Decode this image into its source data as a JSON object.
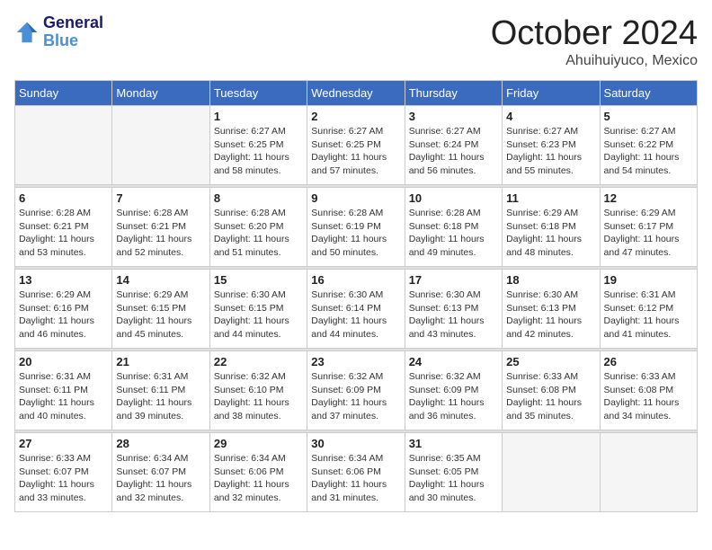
{
  "header": {
    "logo_line1": "General",
    "logo_line2": "Blue",
    "month": "October 2024",
    "location": "Ahuihuiyuco, Mexico"
  },
  "days_of_week": [
    "Sunday",
    "Monday",
    "Tuesday",
    "Wednesday",
    "Thursday",
    "Friday",
    "Saturday"
  ],
  "weeks": [
    [
      {
        "day": "",
        "sunrise": "",
        "sunset": "",
        "daylight": ""
      },
      {
        "day": "",
        "sunrise": "",
        "sunset": "",
        "daylight": ""
      },
      {
        "day": "1",
        "sunrise": "Sunrise: 6:27 AM",
        "sunset": "Sunset: 6:25 PM",
        "daylight": "Daylight: 11 hours and 58 minutes."
      },
      {
        "day": "2",
        "sunrise": "Sunrise: 6:27 AM",
        "sunset": "Sunset: 6:25 PM",
        "daylight": "Daylight: 11 hours and 57 minutes."
      },
      {
        "day": "3",
        "sunrise": "Sunrise: 6:27 AM",
        "sunset": "Sunset: 6:24 PM",
        "daylight": "Daylight: 11 hours and 56 minutes."
      },
      {
        "day": "4",
        "sunrise": "Sunrise: 6:27 AM",
        "sunset": "Sunset: 6:23 PM",
        "daylight": "Daylight: 11 hours and 55 minutes."
      },
      {
        "day": "5",
        "sunrise": "Sunrise: 6:27 AM",
        "sunset": "Sunset: 6:22 PM",
        "daylight": "Daylight: 11 hours and 54 minutes."
      }
    ],
    [
      {
        "day": "6",
        "sunrise": "Sunrise: 6:28 AM",
        "sunset": "Sunset: 6:21 PM",
        "daylight": "Daylight: 11 hours and 53 minutes."
      },
      {
        "day": "7",
        "sunrise": "Sunrise: 6:28 AM",
        "sunset": "Sunset: 6:21 PM",
        "daylight": "Daylight: 11 hours and 52 minutes."
      },
      {
        "day": "8",
        "sunrise": "Sunrise: 6:28 AM",
        "sunset": "Sunset: 6:20 PM",
        "daylight": "Daylight: 11 hours and 51 minutes."
      },
      {
        "day": "9",
        "sunrise": "Sunrise: 6:28 AM",
        "sunset": "Sunset: 6:19 PM",
        "daylight": "Daylight: 11 hours and 50 minutes."
      },
      {
        "day": "10",
        "sunrise": "Sunrise: 6:28 AM",
        "sunset": "Sunset: 6:18 PM",
        "daylight": "Daylight: 11 hours and 49 minutes."
      },
      {
        "day": "11",
        "sunrise": "Sunrise: 6:29 AM",
        "sunset": "Sunset: 6:18 PM",
        "daylight": "Daylight: 11 hours and 48 minutes."
      },
      {
        "day": "12",
        "sunrise": "Sunrise: 6:29 AM",
        "sunset": "Sunset: 6:17 PM",
        "daylight": "Daylight: 11 hours and 47 minutes."
      }
    ],
    [
      {
        "day": "13",
        "sunrise": "Sunrise: 6:29 AM",
        "sunset": "Sunset: 6:16 PM",
        "daylight": "Daylight: 11 hours and 46 minutes."
      },
      {
        "day": "14",
        "sunrise": "Sunrise: 6:29 AM",
        "sunset": "Sunset: 6:15 PM",
        "daylight": "Daylight: 11 hours and 45 minutes."
      },
      {
        "day": "15",
        "sunrise": "Sunrise: 6:30 AM",
        "sunset": "Sunset: 6:15 PM",
        "daylight": "Daylight: 11 hours and 44 minutes."
      },
      {
        "day": "16",
        "sunrise": "Sunrise: 6:30 AM",
        "sunset": "Sunset: 6:14 PM",
        "daylight": "Daylight: 11 hours and 44 minutes."
      },
      {
        "day": "17",
        "sunrise": "Sunrise: 6:30 AM",
        "sunset": "Sunset: 6:13 PM",
        "daylight": "Daylight: 11 hours and 43 minutes."
      },
      {
        "day": "18",
        "sunrise": "Sunrise: 6:30 AM",
        "sunset": "Sunset: 6:13 PM",
        "daylight": "Daylight: 11 hours and 42 minutes."
      },
      {
        "day": "19",
        "sunrise": "Sunrise: 6:31 AM",
        "sunset": "Sunset: 6:12 PM",
        "daylight": "Daylight: 11 hours and 41 minutes."
      }
    ],
    [
      {
        "day": "20",
        "sunrise": "Sunrise: 6:31 AM",
        "sunset": "Sunset: 6:11 PM",
        "daylight": "Daylight: 11 hours and 40 minutes."
      },
      {
        "day": "21",
        "sunrise": "Sunrise: 6:31 AM",
        "sunset": "Sunset: 6:11 PM",
        "daylight": "Daylight: 11 hours and 39 minutes."
      },
      {
        "day": "22",
        "sunrise": "Sunrise: 6:32 AM",
        "sunset": "Sunset: 6:10 PM",
        "daylight": "Daylight: 11 hours and 38 minutes."
      },
      {
        "day": "23",
        "sunrise": "Sunrise: 6:32 AM",
        "sunset": "Sunset: 6:09 PM",
        "daylight": "Daylight: 11 hours and 37 minutes."
      },
      {
        "day": "24",
        "sunrise": "Sunrise: 6:32 AM",
        "sunset": "Sunset: 6:09 PM",
        "daylight": "Daylight: 11 hours and 36 minutes."
      },
      {
        "day": "25",
        "sunrise": "Sunrise: 6:33 AM",
        "sunset": "Sunset: 6:08 PM",
        "daylight": "Daylight: 11 hours and 35 minutes."
      },
      {
        "day": "26",
        "sunrise": "Sunrise: 6:33 AM",
        "sunset": "Sunset: 6:08 PM",
        "daylight": "Daylight: 11 hours and 34 minutes."
      }
    ],
    [
      {
        "day": "27",
        "sunrise": "Sunrise: 6:33 AM",
        "sunset": "Sunset: 6:07 PM",
        "daylight": "Daylight: 11 hours and 33 minutes."
      },
      {
        "day": "28",
        "sunrise": "Sunrise: 6:34 AM",
        "sunset": "Sunset: 6:07 PM",
        "daylight": "Daylight: 11 hours and 32 minutes."
      },
      {
        "day": "29",
        "sunrise": "Sunrise: 6:34 AM",
        "sunset": "Sunset: 6:06 PM",
        "daylight": "Daylight: 11 hours and 32 minutes."
      },
      {
        "day": "30",
        "sunrise": "Sunrise: 6:34 AM",
        "sunset": "Sunset: 6:06 PM",
        "daylight": "Daylight: 11 hours and 31 minutes."
      },
      {
        "day": "31",
        "sunrise": "Sunrise: 6:35 AM",
        "sunset": "Sunset: 6:05 PM",
        "daylight": "Daylight: 11 hours and 30 minutes."
      },
      {
        "day": "",
        "sunrise": "",
        "sunset": "",
        "daylight": ""
      },
      {
        "day": "",
        "sunrise": "",
        "sunset": "",
        "daylight": ""
      }
    ]
  ]
}
